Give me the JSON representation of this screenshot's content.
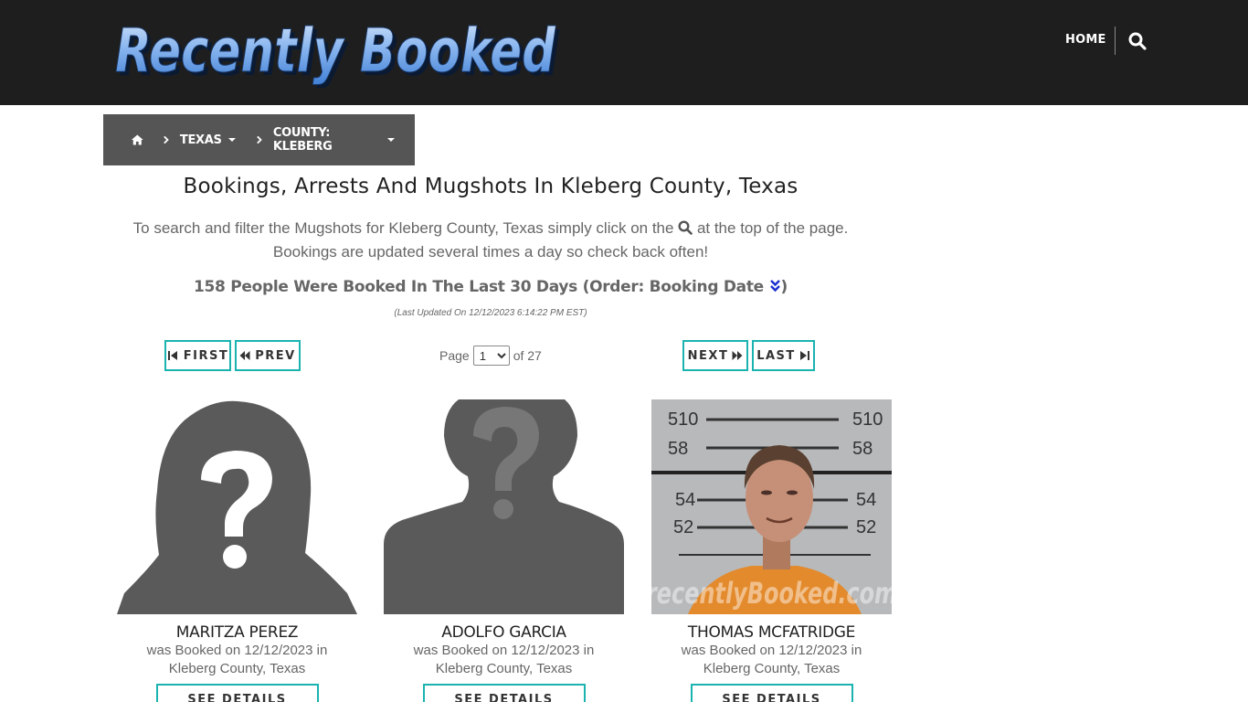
{
  "header": {
    "logo_text": "Recently Booked",
    "nav_home": "HOME",
    "search_icon": "search-icon"
  },
  "breadcrumb": {
    "home_icon": "home-icon",
    "items": [
      "TEXAS",
      "COUNTY: KLEBERG"
    ]
  },
  "main": {
    "title": "Bookings, Arrests And Mugshots In Kleberg County, Texas",
    "intro_before": "To search and filter the Mugshots for Kleberg County, Texas simply click on the",
    "intro_after": "at the top of the page. Bookings are updated several times a day so check back often!",
    "count_text": "158 People Were Booked In The Last 30 Days (Order: Booking Date",
    "count_close": ")",
    "updated": "(Last Updated On 12/12/2023 6:14:22 PM EST)"
  },
  "pager": {
    "first": "FIRST",
    "prev": "PREV",
    "next": "NEXT",
    "last": "LAST",
    "page_label": "Page",
    "page_value": "1",
    "of_label": "of 27"
  },
  "cards": [
    {
      "name": "MARITZA PEREZ",
      "booked_line1": "was Booked on 12/12/2023 in",
      "booked_line2": "Kleberg County, Texas",
      "details": "SEE DETAILS",
      "photo": "female-placeholder"
    },
    {
      "name": "ADOLFO GARCIA",
      "booked_line1": "was Booked on 12/12/2023 in",
      "booked_line2": "Kleberg County, Texas",
      "details": "SEE DETAILS",
      "photo": "male-placeholder"
    },
    {
      "name": "THOMAS MCFATRIDGE",
      "booked_line1": "was Booked on 12/12/2023 in",
      "booked_line2": "Kleberg County, Texas",
      "details": "SEE DETAILS",
      "photo": "mugshot",
      "photo_watermark": "recentlyBooked.com",
      "height_marks": [
        "510",
        "58",
        "54",
        "52",
        "510",
        "58",
        "54",
        "52"
      ]
    }
  ],
  "colors": {
    "header_bg": "#1e1e1e",
    "breadcrumb_bg": "#555555",
    "accent": "#1ab3b0"
  }
}
